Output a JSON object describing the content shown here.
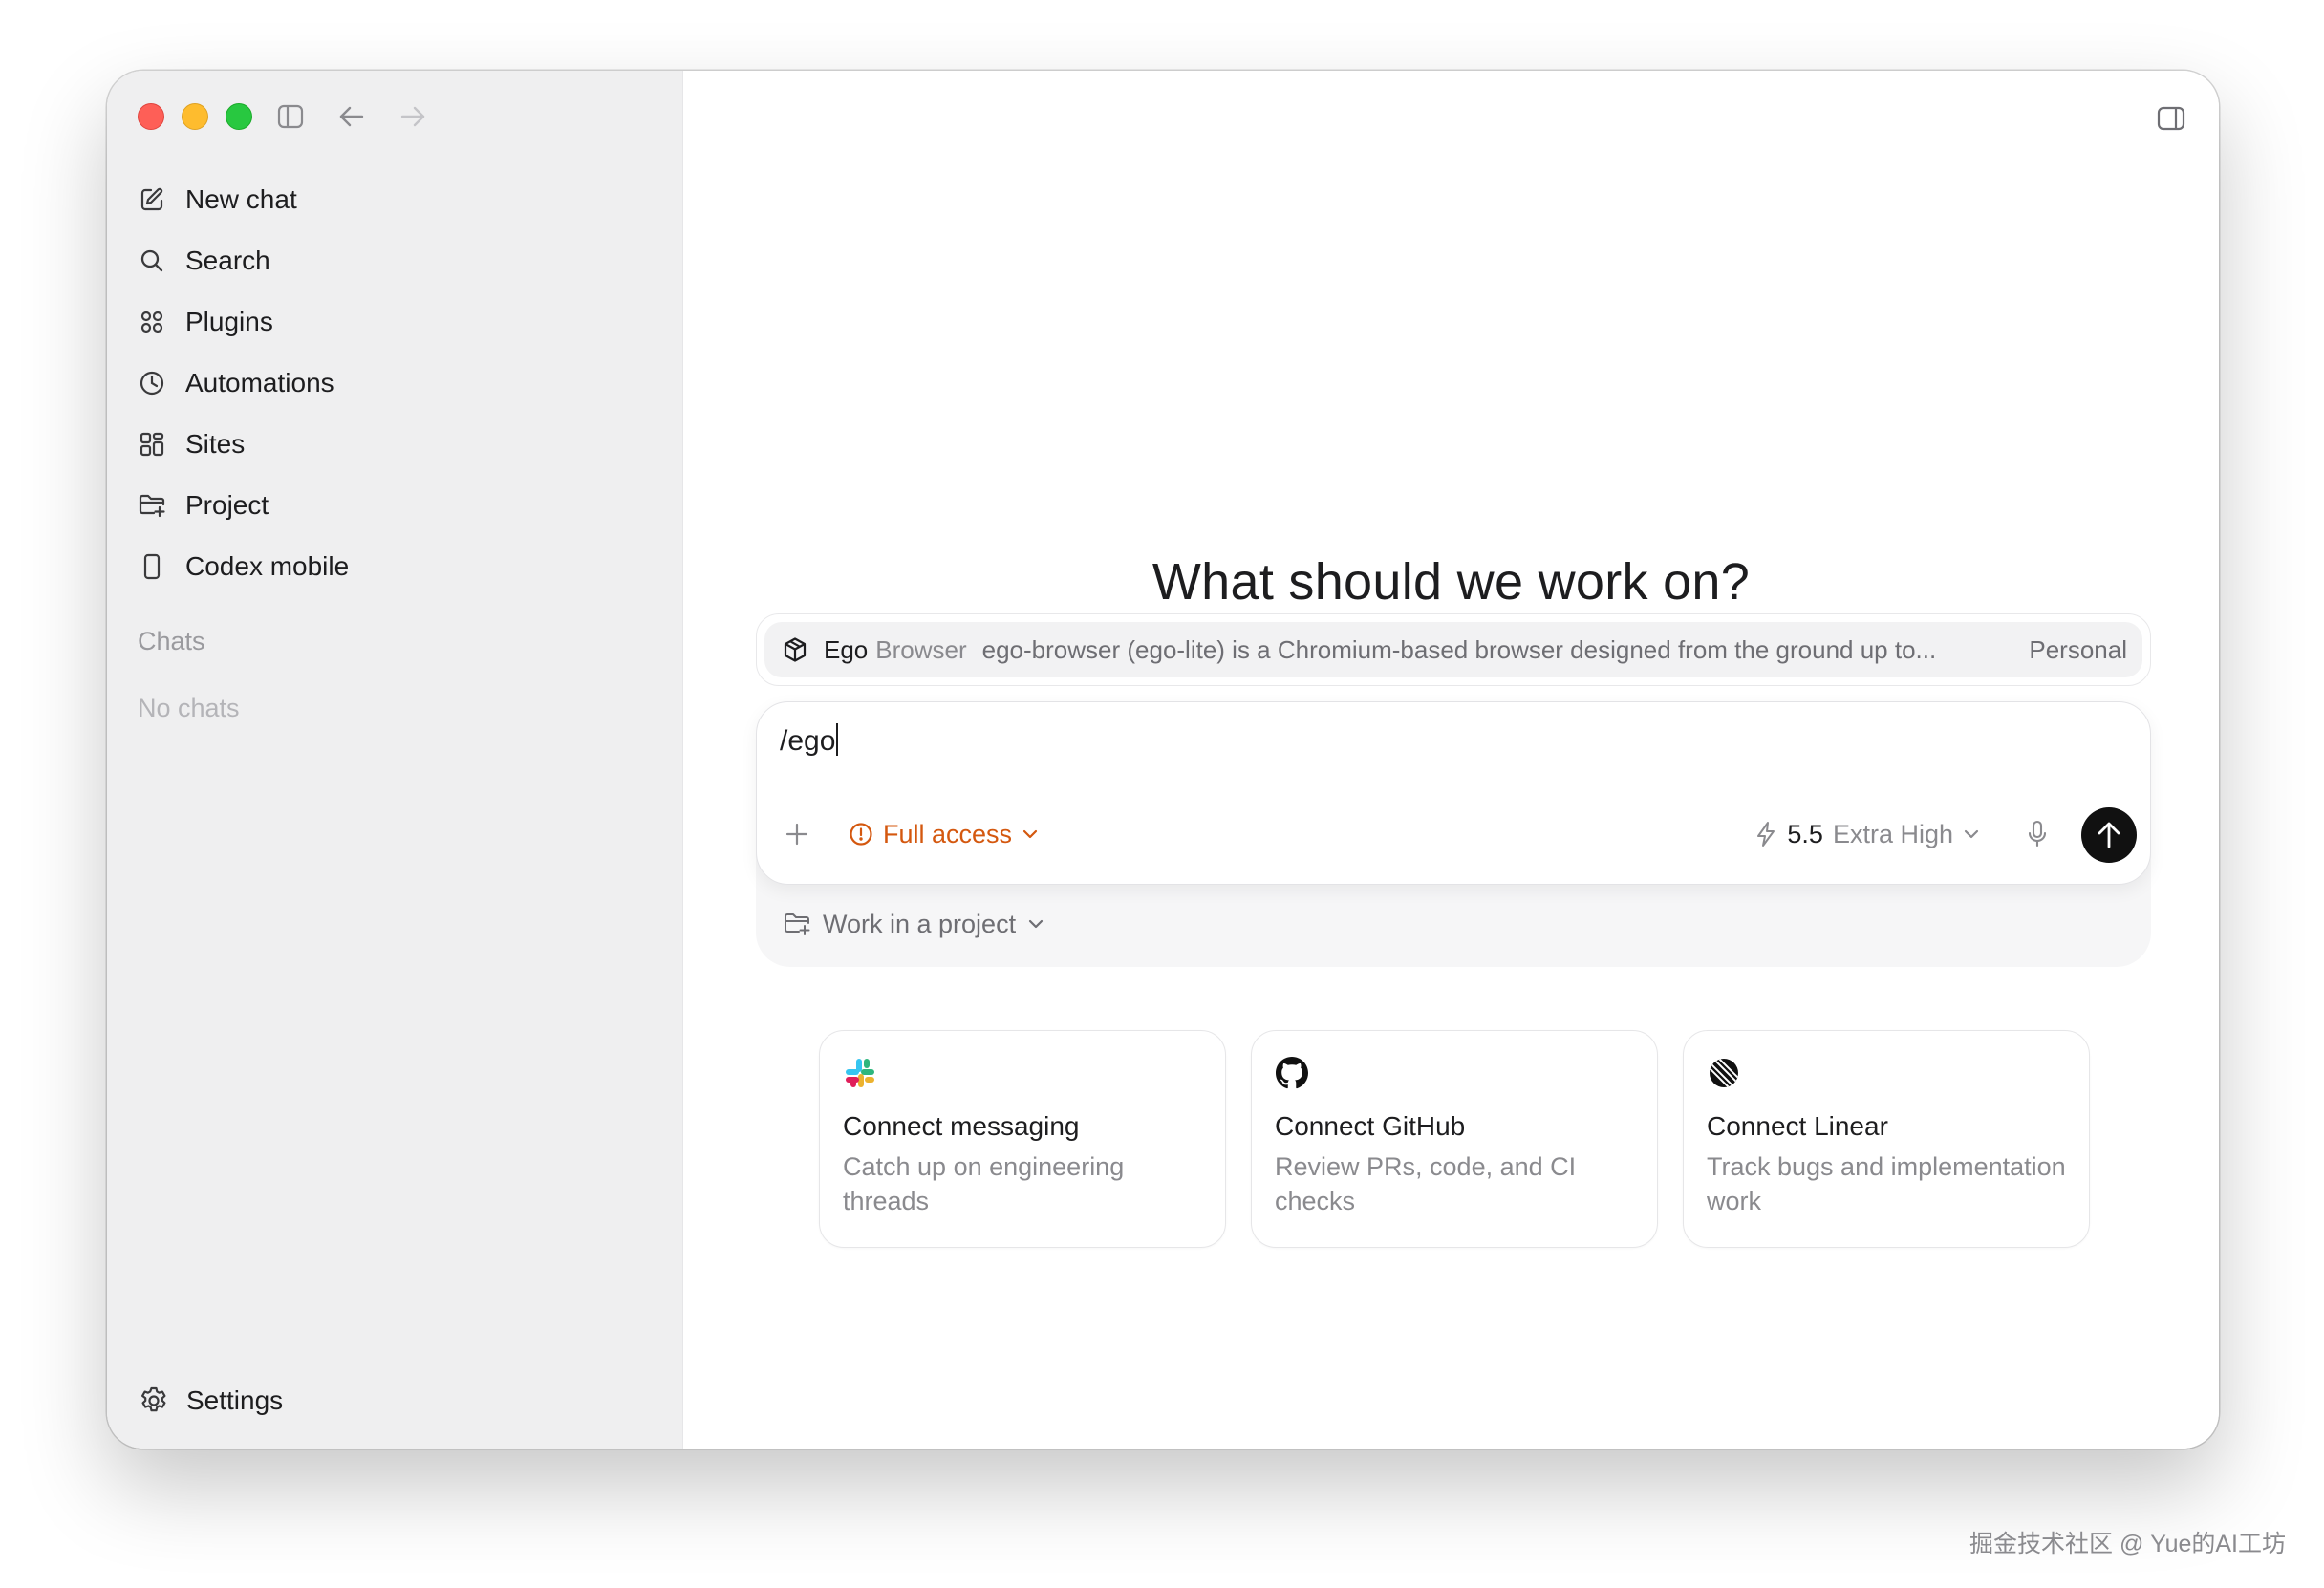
{
  "window": {
    "traffic_lights": [
      "close",
      "minimize",
      "zoom"
    ]
  },
  "toolbar": {
    "sidebar_toggle_icon": "sidebar-icon",
    "back_icon": "arrow-left-icon",
    "forward_icon": "arrow-right-icon"
  },
  "sidebar": {
    "items": [
      {
        "label": "New chat",
        "icon": "compose-icon"
      },
      {
        "label": "Search",
        "icon": "search-icon"
      },
      {
        "label": "Plugins",
        "icon": "plugins-icon"
      },
      {
        "label": "Automations",
        "icon": "clock-icon"
      },
      {
        "label": "Sites",
        "icon": "sites-icon"
      },
      {
        "label": "Project",
        "icon": "folder-icon"
      },
      {
        "label": "Codex mobile",
        "icon": "phone-icon"
      }
    ],
    "chats_label": "Chats",
    "empty_chats": "No chats",
    "settings_label": "Settings"
  },
  "main": {
    "headline": "What should we work on?",
    "suggestion": {
      "name": "Ego",
      "kind": "Browser",
      "description": "ego-browser (ego-lite) is a Chromium-based browser designed from the ground up to...",
      "scope": "Personal"
    },
    "composer": {
      "text": "/ego",
      "access_label": "Full access",
      "model_version": "5.5",
      "model_effort": "Extra High",
      "project_label": "Work in a project"
    },
    "cards": [
      {
        "title": "Connect messaging",
        "description": "Catch up on engineering threads",
        "icon": "slack-icon"
      },
      {
        "title": "Connect GitHub",
        "description": "Review PRs, code, and CI checks",
        "icon": "github-icon"
      },
      {
        "title": "Connect Linear",
        "description": "Track bugs and implementation work",
        "icon": "linear-icon"
      }
    ]
  },
  "watermark": "掘金技术社区 @ Yue的AI工坊",
  "colors": {
    "accent_access": "#d4580f",
    "send_button": "#111111",
    "sidebar_bg": "#efeff0"
  }
}
